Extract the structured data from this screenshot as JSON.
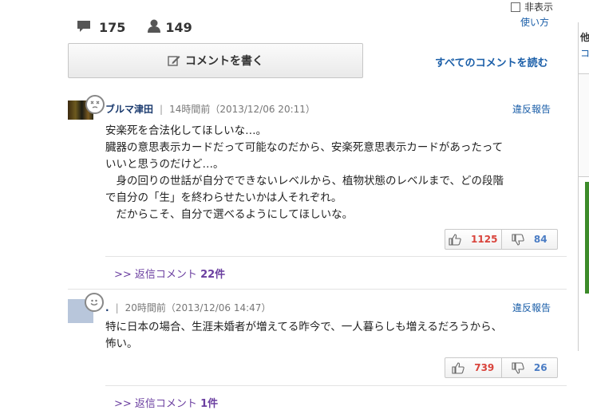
{
  "header": {
    "comment_count": "175",
    "user_count": "149",
    "hide_label": "非表示",
    "howto_label": "使い方",
    "write_button_label": "コメントを書く",
    "read_all_label": "すべてのコメントを読む"
  },
  "sidebar": {
    "title_fragment": "他",
    "link_fragment": "コ"
  },
  "comments": [
    {
      "user": "ブルマ津田",
      "separator": "|",
      "time": "14時間前（2013/12/06 20:11）",
      "report_label": "違反報告",
      "text": "安楽死を合法化してほしいな…。\n臓器の意思表示カードだって可能なのだから、安楽死意思表示カードがあったって\nいいと思うのだけど…。\n　身の回りの世話が自分でできないレベルから、植物状態のレベルまで、どの段階\nで自分の「生」を終わらせたいかは人それぞれ。\n　だからこそ、自分で選べるようにしてほしいな。",
      "good": "1125",
      "bad": "84",
      "replies_prefix": ">> 返信コメント",
      "replies_count": "22件"
    },
    {
      "user": ".",
      "separator": "|",
      "time": "20時間前（2013/12/06 14:47）",
      "report_label": "違反報告",
      "text": "特に日本の場合、生涯未婚者が増えてる昨今で、一人暮らしも増えるだろうから、\n怖い。",
      "good": "739",
      "bad": "26",
      "replies_prefix": ">> 返信コメント",
      "replies_count": "1件"
    }
  ],
  "colors": {
    "link": "#1a5ea8",
    "good": "#d9443c",
    "bad": "#4a7cc4",
    "replies": "#6b3fa0"
  }
}
